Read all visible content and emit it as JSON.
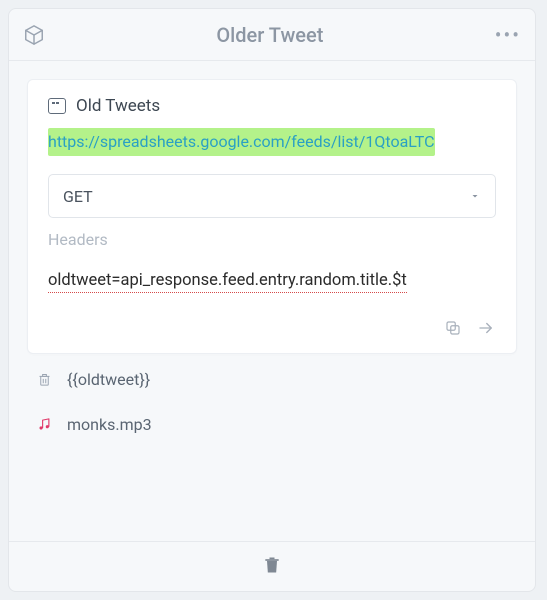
{
  "header": {
    "title": "Older Tweet"
  },
  "card": {
    "title": "Old Tweets",
    "url": "https://spreadsheets.google.com/feeds/list/1QtoaLTC",
    "method": "GET",
    "headers_placeholder": "Headers",
    "expression": "oldtweet=api_response.feed.entry.random.title.$t"
  },
  "rows": {
    "text_item": "{{oldtweet}}",
    "audio_item": "monks.mp3"
  }
}
